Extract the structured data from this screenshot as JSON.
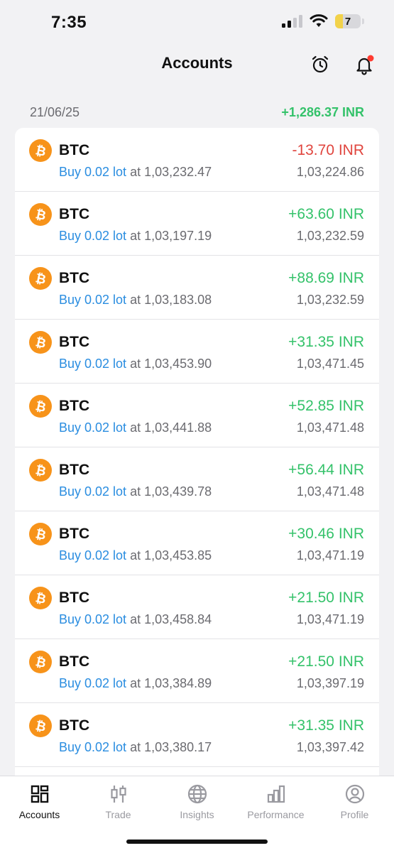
{
  "status_bar": {
    "time": "7:35",
    "battery_level": "7"
  },
  "header": {
    "title": "Accounts",
    "alarm_icon": "alarm-clock-icon",
    "bell_icon": "bell-icon",
    "notification_dot_color": "#ff3b30"
  },
  "summary": {
    "date": "21/06/25",
    "total_pnl": "+1,286.37 INR"
  },
  "colors": {
    "profit": "#34c26a",
    "loss": "#e0453e",
    "link": "#2a8de0",
    "coin": "#f7931a"
  },
  "trades": [
    {
      "symbol": "BTC",
      "side_label": "Buy 0.02 lot",
      "at_price": " at 1,03,232.47",
      "pnl": "-13.70 INR",
      "pnl_sign": "neg",
      "current_price": "1,03,224.86"
    },
    {
      "symbol": "BTC",
      "side_label": "Buy 0.02 lot",
      "at_price": " at 1,03,197.19",
      "pnl": "+63.60 INR",
      "pnl_sign": "pos",
      "current_price": "1,03,232.59"
    },
    {
      "symbol": "BTC",
      "side_label": "Buy 0.02 lot",
      "at_price": " at 1,03,183.08",
      "pnl": "+88.69 INR",
      "pnl_sign": "pos",
      "current_price": "1,03,232.59"
    },
    {
      "symbol": "BTC",
      "side_label": "Buy 0.02 lot",
      "at_price": " at 1,03,453.90",
      "pnl": "+31.35 INR",
      "pnl_sign": "pos",
      "current_price": "1,03,471.45"
    },
    {
      "symbol": "BTC",
      "side_label": "Buy 0.02 lot",
      "at_price": " at 1,03,441.88",
      "pnl": "+52.85 INR",
      "pnl_sign": "pos",
      "current_price": "1,03,471.48"
    },
    {
      "symbol": "BTC",
      "side_label": "Buy 0.02 lot",
      "at_price": " at 1,03,439.78",
      "pnl": "+56.44 INR",
      "pnl_sign": "pos",
      "current_price": "1,03,471.48"
    },
    {
      "symbol": "BTC",
      "side_label": "Buy 0.02 lot",
      "at_price": " at 1,03,453.85",
      "pnl": "+30.46 INR",
      "pnl_sign": "pos",
      "current_price": "1,03,471.19"
    },
    {
      "symbol": "BTC",
      "side_label": "Buy 0.02 lot",
      "at_price": " at 1,03,458.84",
      "pnl": "+21.50 INR",
      "pnl_sign": "pos",
      "current_price": "1,03,471.19"
    },
    {
      "symbol": "BTC",
      "side_label": "Buy 0.02 lot",
      "at_price": " at 1,03,384.89",
      "pnl": "+21.50 INR",
      "pnl_sign": "pos",
      "current_price": "1,03,397.19"
    },
    {
      "symbol": "BTC",
      "side_label": "Buy 0.02 lot",
      "at_price": " at 1,03,380.17",
      "pnl": "+31.35 INR",
      "pnl_sign": "pos",
      "current_price": "1,03,397.42"
    }
  ],
  "nav": {
    "items": [
      {
        "label": "Accounts",
        "icon": "grid-icon",
        "active": true
      },
      {
        "label": "Trade",
        "icon": "candlestick-icon",
        "active": false
      },
      {
        "label": "Insights",
        "icon": "globe-icon",
        "active": false
      },
      {
        "label": "Performance",
        "icon": "bar-chart-icon",
        "active": false
      },
      {
        "label": "Profile",
        "icon": "user-circle-icon",
        "active": false
      }
    ]
  }
}
